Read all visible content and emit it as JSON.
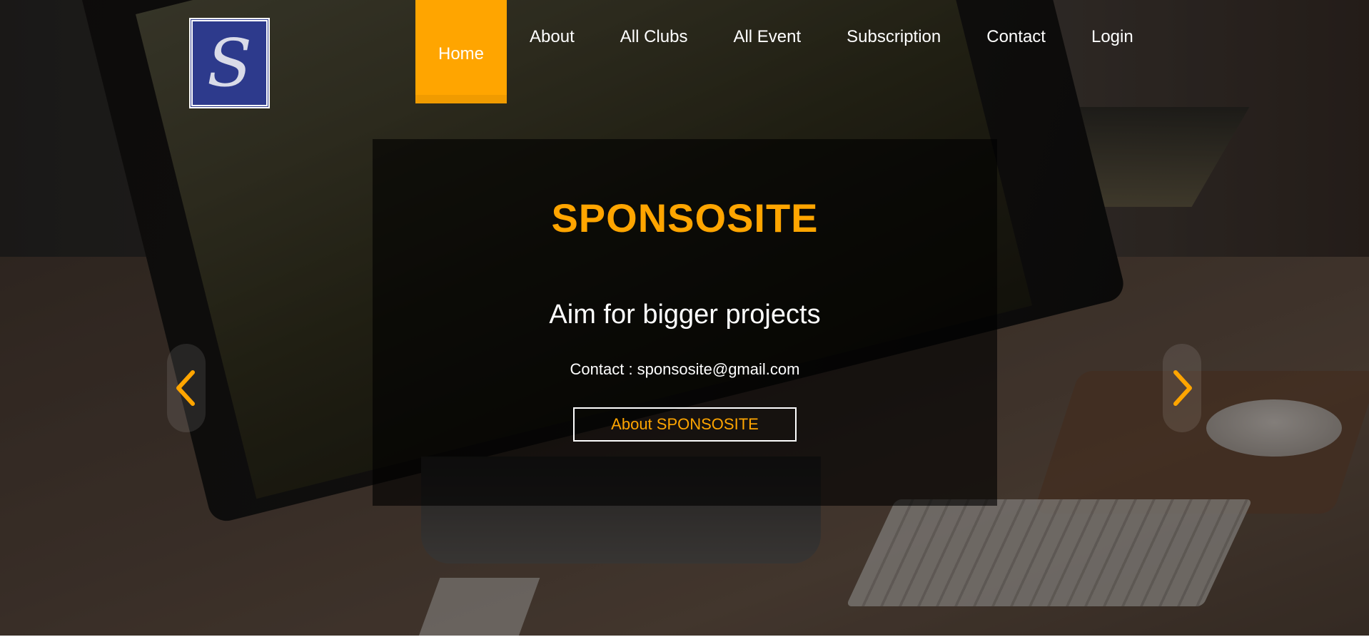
{
  "header": {
    "logo_icon": "s-monogram-logo",
    "logo_letter": "S",
    "nav": [
      {
        "label": "Home",
        "active": true
      },
      {
        "label": "About",
        "active": false
      },
      {
        "label": "All Clubs",
        "active": false
      },
      {
        "label": "All Event",
        "active": false
      },
      {
        "label": "Subscription",
        "active": false
      },
      {
        "label": "Contact",
        "active": false
      },
      {
        "label": "Login",
        "active": false
      }
    ]
  },
  "hero": {
    "title": "SPONSOSITE",
    "tagline": "Aim for bigger projects",
    "contact": "Contact : sponsosite@gmail.com",
    "button_label": "About SPONSOSITE",
    "prev_icon": "chevron-left-icon",
    "next_icon": "chevron-right-icon"
  },
  "colors": {
    "accent": "#ffa500",
    "logo_bg": "#2d3a8c",
    "text": "#ffffff"
  }
}
